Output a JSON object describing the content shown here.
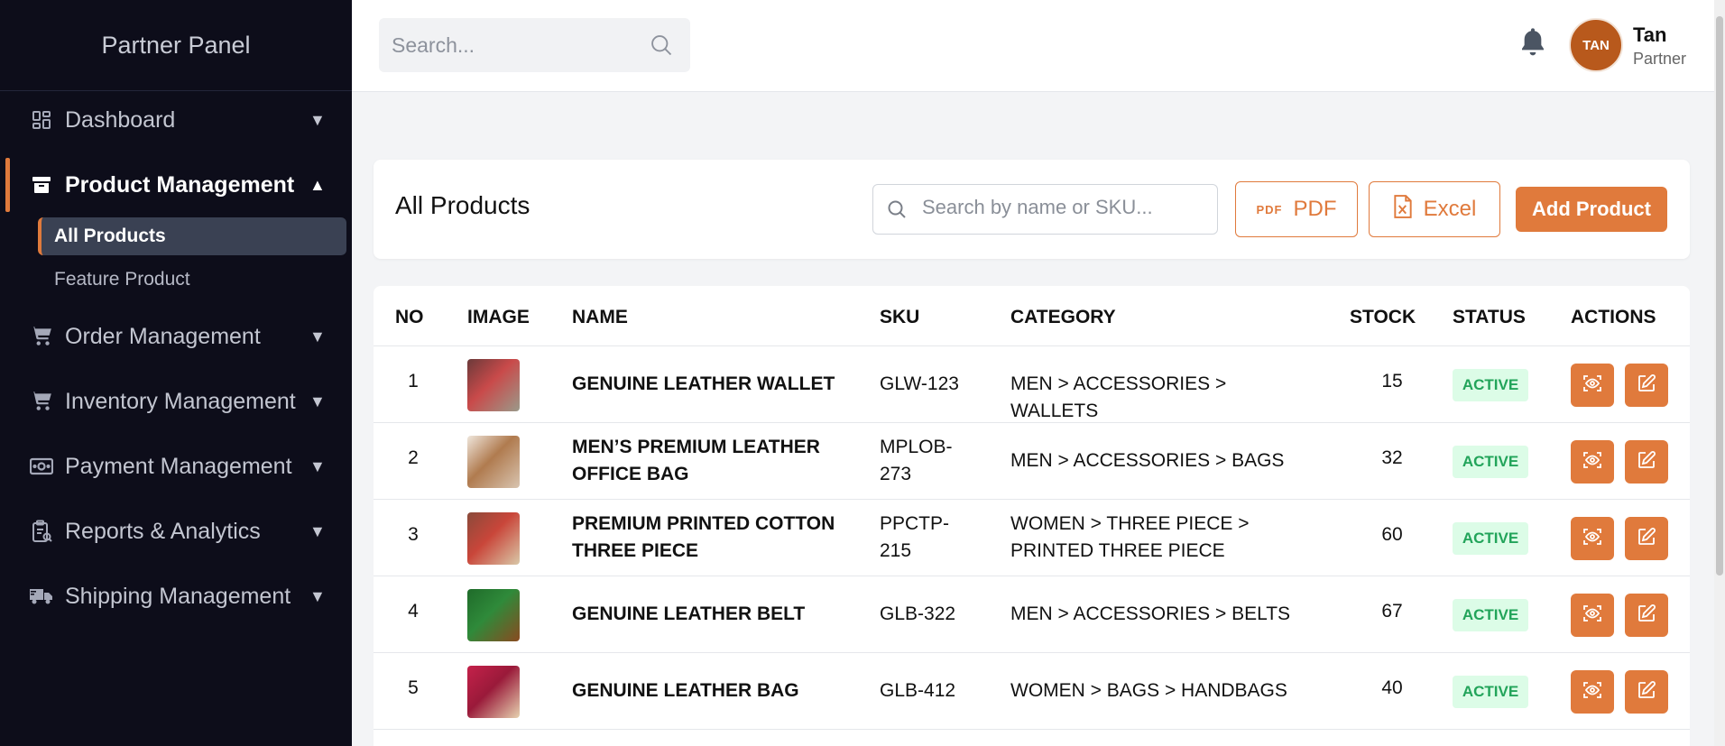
{
  "sidebar": {
    "brand": "Partner Panel",
    "items": [
      {
        "label": "Dashboard",
        "icon": "dashboard-grid-icon",
        "caret": "▼"
      },
      {
        "label": "Product Management",
        "icon": "archive-box-icon",
        "caret": "▲",
        "active": true
      },
      {
        "label": "Order Management",
        "icon": "shopping-cart-icon",
        "caret": "▼"
      },
      {
        "label": "Inventory Management",
        "icon": "shopping-cart-icon",
        "caret": "▼"
      },
      {
        "label": "Payment Management",
        "icon": "money-bill-icon",
        "caret": "▼"
      },
      {
        "label": "Reports & Analytics",
        "icon": "clipboard-report-icon",
        "caret": "▼"
      },
      {
        "label": "Shipping Management",
        "icon": "truck-icon",
        "caret": "▼"
      }
    ],
    "subitems": [
      {
        "label": "All Products",
        "active": true
      },
      {
        "label": "Feature Product"
      }
    ]
  },
  "header": {
    "search_placeholder": "Search...",
    "user": {
      "initials": "TAN",
      "name": "Tan",
      "role": "Partner"
    }
  },
  "toolbar": {
    "title": "All Products",
    "search_placeholder": "Search by name or SKU...",
    "pdf_mark": "PDF",
    "pdf_label": "PDF",
    "excel_label": "Excel",
    "add_label": "Add Product"
  },
  "table": {
    "columns": [
      "NO",
      "IMAGE",
      "NAME",
      "SKU",
      "CATEGORY",
      "STOCK",
      "STATUS",
      "ACTIONS"
    ],
    "rows": [
      {
        "no": "1",
        "name_lines": [
          "GENUINE LEATHER WALLET"
        ],
        "sku_lines": [
          "GLW-123"
        ],
        "cat_lines": [
          "MEN > ACCESSORIES > WALLETS"
        ],
        "stock": "15",
        "status": "ACTIVE",
        "thumb": [
          "#6b3a3a",
          "#c94a4a",
          "#9a9a8a"
        ]
      },
      {
        "no": "2",
        "name_lines": [
          "MEN’S PREMIUM LEATHER",
          "OFFICE BAG"
        ],
        "sku_lines": [
          "MPLOB-",
          "273"
        ],
        "cat_lines": [
          "MEN > ACCESSORIES > BAGS"
        ],
        "stock": "32",
        "status": "ACTIVE",
        "thumb": [
          "#efe6dc",
          "#b07b4f",
          "#d8c4b0"
        ]
      },
      {
        "no": "3",
        "name_lines": [
          "PREMIUM PRINTED COTTON",
          "THREE PIECE"
        ],
        "sku_lines": [
          "PPCTP-",
          "215"
        ],
        "cat_lines": [
          "WOMEN > THREE PIECE >",
          "PRINTED THREE PIECE"
        ],
        "stock": "60",
        "status": "ACTIVE",
        "thumb": [
          "#8a4a3a",
          "#c9463a",
          "#d9c8a8"
        ]
      },
      {
        "no": "4",
        "name_lines": [
          "GENUINE LEATHER BELT"
        ],
        "sku_lines": [
          "GLB-322"
        ],
        "cat_lines": [
          "MEN > ACCESSORIES > BELTS"
        ],
        "stock": "67",
        "status": "ACTIVE",
        "thumb": [
          "#1f6b2a",
          "#2f8a3a",
          "#8a4a20"
        ]
      },
      {
        "no": "5",
        "name_lines": [
          "GENUINE LEATHER BAG"
        ],
        "sku_lines": [
          "GLB-412"
        ],
        "cat_lines": [
          "WOMEN > BAGS > HANDBAGS"
        ],
        "stock": "40",
        "status": "ACTIVE",
        "thumb": [
          "#c4214a",
          "#9a1a3a",
          "#e6d2b0"
        ]
      }
    ]
  },
  "colors": {
    "accent": "#e07a3c",
    "sidebar_bg": "#0d0d1a",
    "active_badge_bg": "#dcfce7",
    "active_badge_text": "#22a45a"
  }
}
